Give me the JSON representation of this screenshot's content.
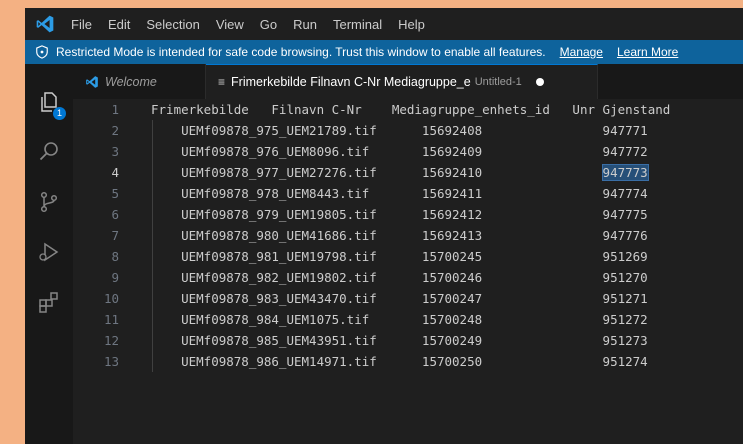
{
  "menubar": {
    "items": [
      "File",
      "Edit",
      "Selection",
      "View",
      "Go",
      "Run",
      "Terminal",
      "Help"
    ]
  },
  "banner": {
    "message": "Restricted Mode is intended for safe code browsing. Trust this window to enable all features.",
    "manage_label": "Manage",
    "learn_more_label": "Learn More"
  },
  "activity_bar": {
    "explorer_badge": "1",
    "icons": [
      "explorer-icon",
      "search-icon",
      "source-control-icon",
      "run-debug-icon",
      "extensions-icon"
    ]
  },
  "tabs": [
    {
      "label": "Welcome",
      "active": false
    },
    {
      "label": "Frimerkebilde Filnavn C-Nr Mediagruppe_e",
      "description": "Untitled-1",
      "dirty": true,
      "active": true
    }
  ],
  "editor": {
    "active_line": 4,
    "selected_text": "947773",
    "lines": [
      {
        "n": "1",
        "text": "Frimerkebilde   Filnavn C-Nr    Mediagruppe_enhets_id   Unr Gjenstand"
      },
      {
        "n": "2",
        "text": "    UEMf09878_975_UEM21789.tif      15692408                947771"
      },
      {
        "n": "3",
        "text": "    UEMf09878_976_UEM8096.tif       15692409                947772"
      },
      {
        "n": "4",
        "text": "    UEMf09878_977_UEM27276.tif      15692410                ",
        "selected": "947773"
      },
      {
        "n": "5",
        "text": "    UEMf09878_978_UEM8443.tif       15692411                947774"
      },
      {
        "n": "6",
        "text": "    UEMf09878_979_UEM19805.tif      15692412                947775"
      },
      {
        "n": "7",
        "text": "    UEMf09878_980_UEM41686.tif      15692413                947776"
      },
      {
        "n": "8",
        "text": "    UEMf09878_981_UEM19798.tif      15700245                951269"
      },
      {
        "n": "9",
        "text": "    UEMf09878_982_UEM19802.tif      15700246                951270"
      },
      {
        "n": "10",
        "text": "    UEMf09878_983_UEM43470.tif      15700247                951271"
      },
      {
        "n": "11",
        "text": "    UEMf09878_984_UEM1075.tif       15700248                951272"
      },
      {
        "n": "12",
        "text": "    UEMf09878_985_UEM43951.tif      15700249                951273"
      },
      {
        "n": "13",
        "text": "    UEMf09878_986_UEM14971.tif      15700250                951274"
      }
    ]
  },
  "colors": {
    "outer_background": "#f4b183",
    "banner": "#0e639c",
    "accent": "#0078d4",
    "editor_background": "#1f1f1f"
  }
}
